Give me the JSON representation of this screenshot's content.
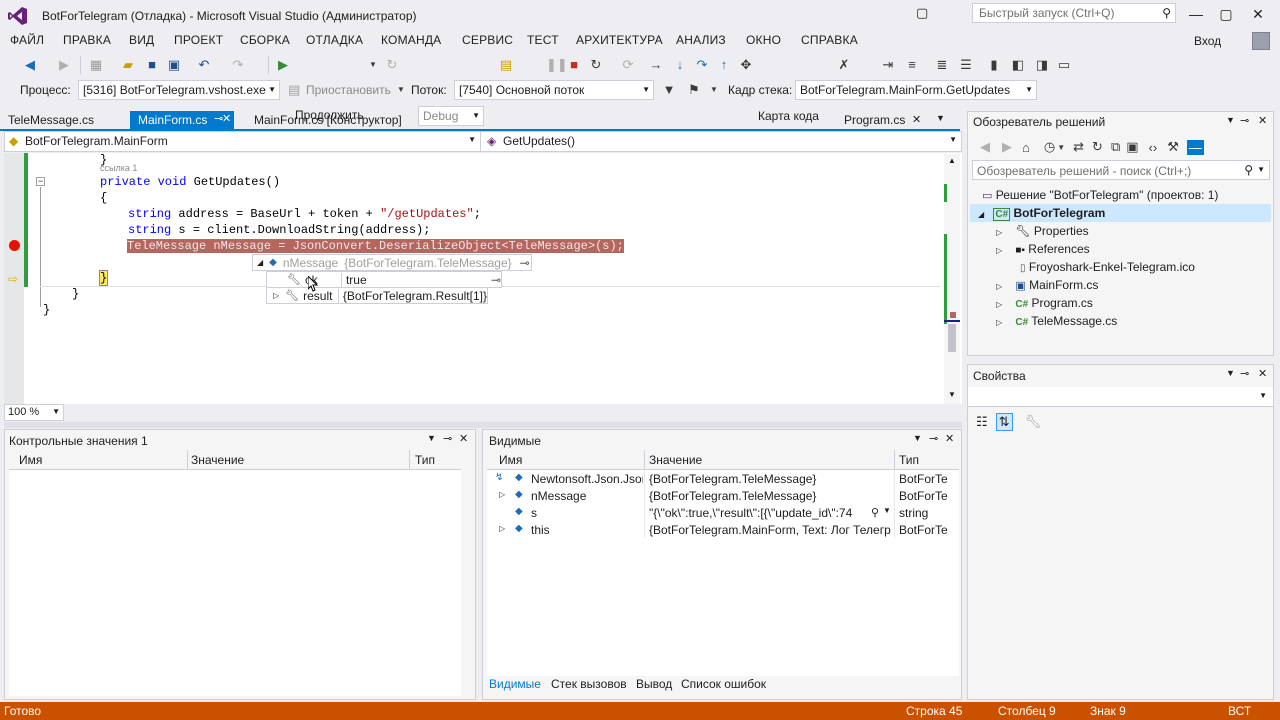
{
  "window": {
    "title": "BotForTelegram (Отладка) - Microsoft Visual Studio (Администратор)",
    "quick_launch_placeholder": "Быстрый запуск (Ctrl+Q)",
    "login": "Вход"
  },
  "menu": [
    "ФАЙЛ",
    "ПРАВКА",
    "ВИД",
    "ПРОЕКТ",
    "СБОРКА",
    "ОТЛАДКА",
    "КОМАНДА",
    "СЕРВИС",
    "ТЕСТ",
    "АРХИТЕКТУРА",
    "АНАЛИЗ",
    "ОКНО",
    "СПРАВКА"
  ],
  "toolbar": {
    "continue_label": "Продолжить",
    "config": "Debug",
    "code_map_label": "Карта кода",
    "process_label": "Процесс:",
    "process_value": "[5316] BotForTelegram.vshost.exe",
    "suspend_label": "Приостановить",
    "thread_label": "Поток:",
    "thread_value": "[7540] Основной поток",
    "stack_frame_label": "Кадр стека:",
    "stack_frame_value": "BotForTelegram.MainForm.GetUpdates"
  },
  "doc_tabs": {
    "tab1": "TeleMessage.cs",
    "tab2": "MainForm.cs",
    "tab3": "MainForm.cs [Конструктор]",
    "tab4": "Program.cs"
  },
  "nav": {
    "class": "BotForTelegram.MainForm",
    "method": "GetUpdates()"
  },
  "code": {
    "line0": "}",
    "codelens": "ссылка 1",
    "line1_kw": "private void",
    "line1_rest": " GetUpdates()",
    "line2": "{",
    "line3_kw": "string",
    "line3_a": " address = BaseUrl + token + ",
    "line3_str": "\"/getUpdates\"",
    "line3_end": ";",
    "line4_kw": "string",
    "line4_rest": " s = client.DownloadString(address);",
    "line5": "TeleMessage nMessage = JsonConvert.DeserializeObject<TeleMessage>(s);",
    "line6": "}",
    "line7": "}",
    "line8": "}"
  },
  "datatip": {
    "root_name": "nMessage",
    "root_value": "{BotForTelegram.TeleMessage}",
    "row1_name": "ok",
    "row1_value": "true",
    "row2_name": "result",
    "row2_value": "{BotForTelegram.Result[1]}"
  },
  "zoom": "100 %",
  "watch": {
    "title": "Контрольные значения 1",
    "col_name": "Имя",
    "col_value": "Значение",
    "col_type": "Тип"
  },
  "autos": {
    "title": "Видимые",
    "col_name": "Имя",
    "col_value": "Значение",
    "col_type": "Тип",
    "rows": [
      {
        "name": "Newtonsoft.Json.Json",
        "value": "{BotForTelegram.TeleMessage}",
        "type": "BotForTe"
      },
      {
        "name": "nMessage",
        "value": "{BotForTelegram.TeleMessage}",
        "type": "BotForTe"
      },
      {
        "name": "s",
        "value": "\"{\\\"ok\\\":true,\\\"result\\\":[{\\\"update_id\\\":74",
        "type": "string"
      },
      {
        "name": "this",
        "value": "{BotForTelegram.MainForm, Text: Лог Телегр",
        "type": "BotForTe"
      }
    ],
    "bottom_tabs": [
      "Видимые",
      "Стек вызовов",
      "Вывод",
      "Список ошибок"
    ]
  },
  "solution": {
    "title": "Обозреватель решений",
    "search_placeholder": "Обозреватель решений - поиск (Ctrl+;)",
    "root": "Решение \"BotForTelegram\"  (проектов: 1)",
    "project": "BotForTelegram",
    "items": [
      "Properties",
      "References",
      "Froyoshark-Enkel-Telegram.ico",
      "MainForm.cs",
      "Program.cs",
      "TeleMessage.cs"
    ]
  },
  "properties": {
    "title": "Свойства"
  },
  "status": {
    "ready": "Готово",
    "line": "Строка 45",
    "col": "Столбец 9",
    "char": "Знак 9",
    "mode": "ВСТ"
  },
  "colors": {
    "accent": "#007acc",
    "status": "#ca5100",
    "breakpoint": "#e51400"
  }
}
